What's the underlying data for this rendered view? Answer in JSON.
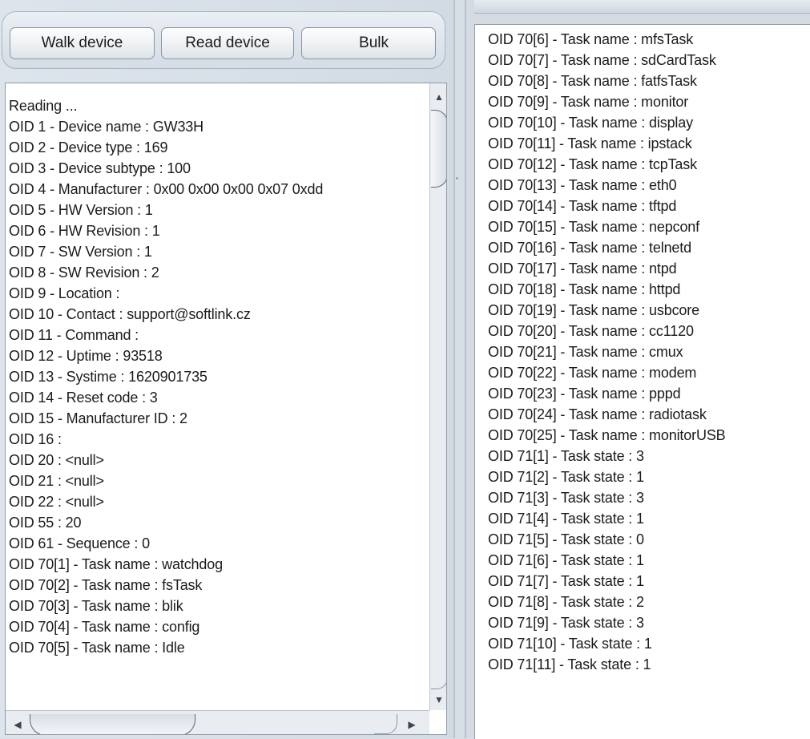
{
  "toolbar": {
    "walk_label": "Walk device",
    "read_label": "Read device",
    "bulk_label": "Bulk"
  },
  "left_output": {
    "lines": [
      "Reading ...",
      "OID 1 - Device name : GW33H",
      "OID 2 - Device type : 169",
      "OID 3 - Device subtype : 100",
      "OID 4 - Manufacturer : 0x00 0x00 0x00 0x07 0xdd",
      "OID 5 - HW Version : 1",
      "OID 6 - HW Revision : 1",
      "OID 7 - SW Version : 1",
      "OID 8 - SW Revision : 2",
      "OID 9 - Location :",
      "OID 10 - Contact : support@softlink.cz",
      "OID 11 - Command :",
      "OID 12 - Uptime : 93518",
      "OID 13 - Systime : 1620901735",
      "OID 14 - Reset code : 3",
      "OID 15 - Manufacturer ID : 2",
      "OID 16 :",
      "OID 20 : <null>",
      "OID 21 : <null>",
      "OID 22 : <null>",
      "OID 55 : 20",
      "OID 61 - Sequence : 0",
      "OID 70[1] - Task name : watchdog",
      "OID 70[2] - Task name : fsTask",
      "OID 70[3] - Task name : blik",
      "OID 70[4] - Task name : config",
      "OID 70[5] - Task name : Idle"
    ]
  },
  "right_output": {
    "lines": [
      "OID 70[6] - Task name : mfsTask",
      "OID 70[7] - Task name : sdCardTask",
      "OID 70[8] - Task name : fatfsTask",
      "OID 70[9] - Task name : monitor",
      "OID 70[10] - Task name : display",
      "OID 70[11] - Task name : ipstack",
      "OID 70[12] - Task name : tcpTask",
      "OID 70[13] - Task name : eth0",
      "OID 70[14] - Task name : tftpd",
      "OID 70[15] - Task name : nepconf",
      "OID 70[16] - Task name : telnetd",
      "OID 70[17] - Task name : ntpd",
      "OID 70[18] - Task name : httpd",
      "OID 70[19] - Task name : usbcore",
      "OID 70[20] - Task name : cc1120",
      "OID 70[21] - Task name : cmux",
      "OID 70[22] - Task name : modem",
      "OID 70[23] - Task name : pppd",
      "OID 70[24] - Task name : radiotask",
      "OID 70[25] - Task name : monitorUSB",
      "OID 71[1] - Task state : 3",
      "OID 71[2] - Task state : 1",
      "OID 71[3] - Task state : 3",
      "OID 71[4] - Task state : 1",
      "OID 71[5] - Task state : 0",
      "OID 71[6] - Task state : 1",
      "OID 71[7] - Task state : 1",
      "OID 71[8] - Task state : 2",
      "OID 71[9] - Task state : 3",
      "OID 71[10] - Task state : 1",
      "OID 71[11] - Task state : 1"
    ]
  },
  "icons": {
    "scroll_up": "arrow-up-icon",
    "scroll_down": "arrow-down-icon",
    "scroll_left": "arrow-left-icon",
    "scroll_right": "arrow-right-icon"
  },
  "colors": {
    "panel_background": "#d8dfe7",
    "text_area_background": "#ffffff",
    "border": "#8e99a6"
  }
}
